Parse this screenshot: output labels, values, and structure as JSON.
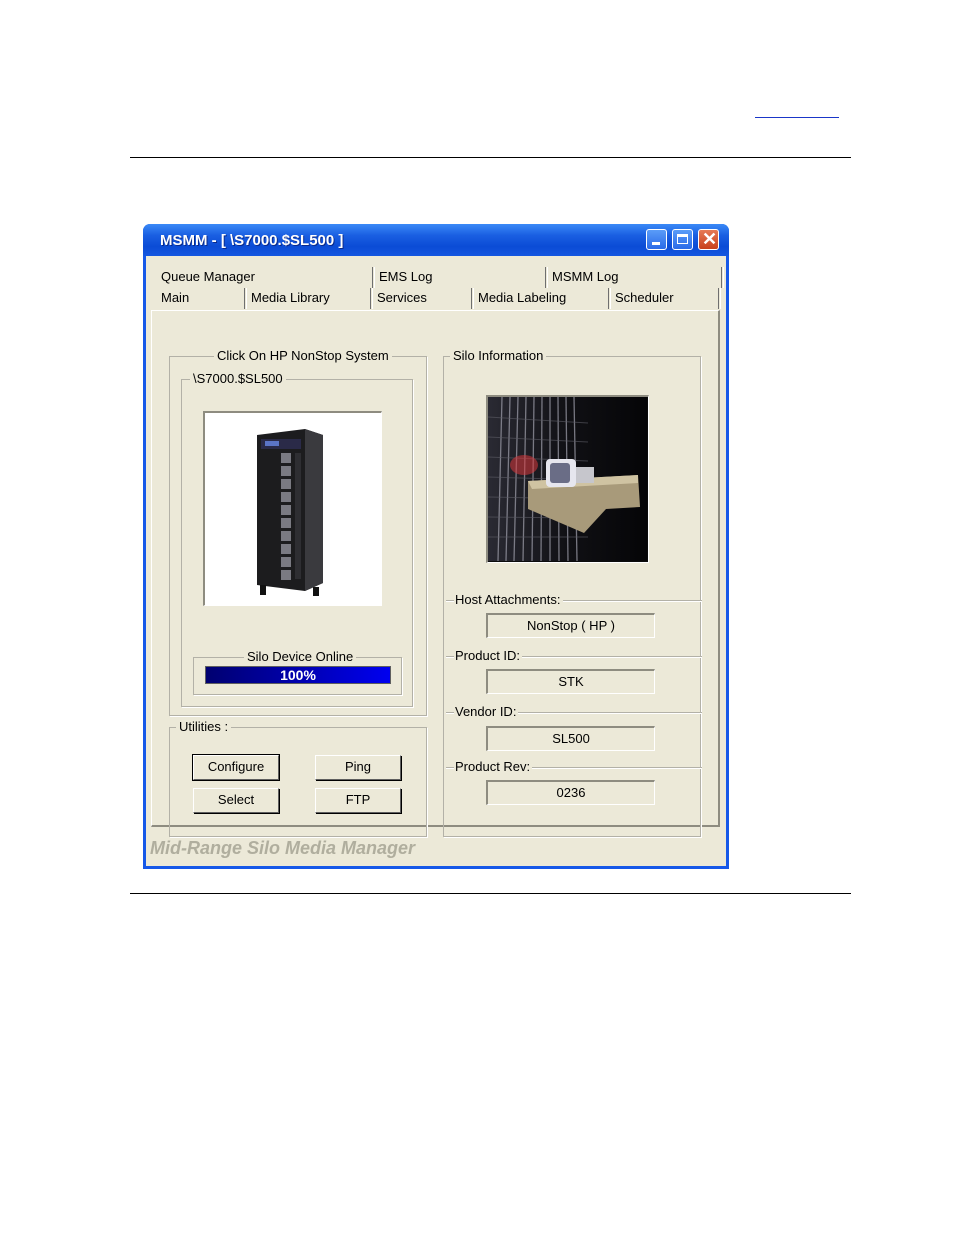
{
  "window": {
    "title": "MSMM - [ \\S7000.$SL500 ]",
    "accent": "#1658e8"
  },
  "tabs": {
    "row1": [
      "Queue Manager",
      "EMS Log",
      "MSMM Log"
    ],
    "row2": [
      "Main",
      "Media Library",
      "Services",
      "Media Labeling",
      "Scheduler"
    ],
    "active": "Main"
  },
  "system_group": {
    "legend": "Click On HP NonStop System",
    "system_legend": "\\S7000.$SL500",
    "image": "tape-library-cabinet",
    "status_legend": "Silo Device Online",
    "progress_label": "100%",
    "progress_value": 1.0
  },
  "utilities": {
    "legend": "Utilities :",
    "buttons": [
      "Configure",
      "Ping",
      "Select",
      "FTP"
    ],
    "default_button": "Configure"
  },
  "silo_info": {
    "legend": "Silo Information",
    "image": "tape-robot-photo",
    "fields": [
      {
        "label": "Host Attachments:",
        "value": "NonStop ( HP )"
      },
      {
        "label": "Product ID:",
        "value": "STK"
      },
      {
        "label": "Vendor ID:",
        "value": "SL500"
      },
      {
        "label": "Product Rev:",
        "value": "0236"
      }
    ]
  },
  "footer": "Mid-Range Silo Media Manager"
}
